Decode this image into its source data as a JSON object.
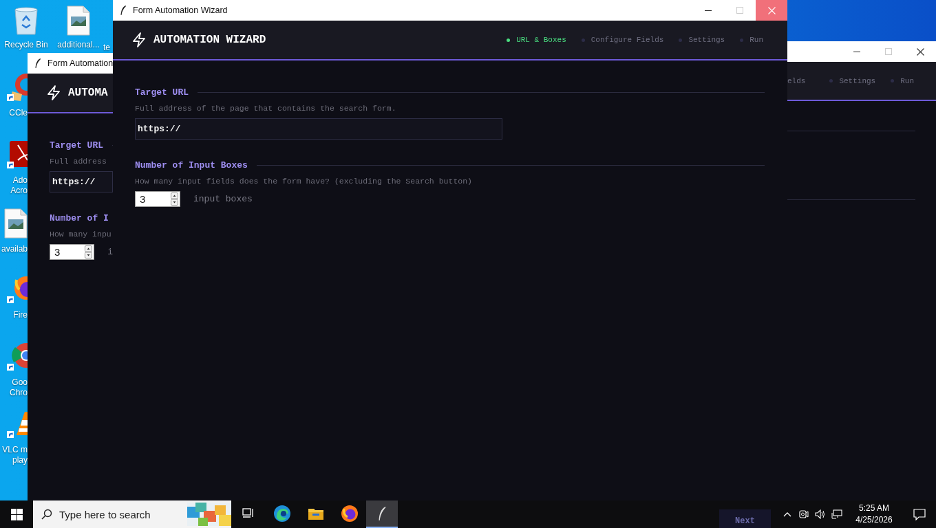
{
  "desktop": {
    "icons_top": [
      {
        "kind": "recycle",
        "label": "Recycle Bin"
      },
      {
        "kind": "image_file",
        "label": "additional..."
      },
      {
        "kind": "none",
        "label": "te"
      }
    ],
    "icons_side": [
      {
        "kind": "ccleaner",
        "lines": [
          "CCle"
        ]
      },
      {
        "kind": "acrobat",
        "lines": [
          "Ado",
          "Acro"
        ]
      },
      {
        "kind": "image_file",
        "lines": [
          "availab"
        ]
      },
      {
        "kind": "firefox",
        "lines": [
          "Fire"
        ]
      },
      {
        "kind": "chrome",
        "lines": [
          "Goo",
          "Chro"
        ]
      },
      {
        "kind": "vlc",
        "lines": [
          "VLC m",
          "play"
        ]
      }
    ]
  },
  "back_window_left": {
    "title": "Form Automation",
    "heading": "AUTOMA",
    "sections": [
      {
        "kind": "text",
        "heading": "Target URL",
        "description": "Full address",
        "value": "https://"
      },
      {
        "kind": "spin",
        "heading": "Number of I",
        "description": "How many inpu",
        "value": "3",
        "unit": "i"
      }
    ]
  },
  "back_window_right": {
    "partial_step": "elds",
    "steps": [
      {
        "label": "Settings",
        "selected": false
      },
      {
        "label": "Run",
        "selected": false
      }
    ]
  },
  "window": {
    "title": "Form Automation Wizard",
    "heading": "AUTOMATION WIZARD",
    "steps": [
      {
        "label": "URL & Boxes",
        "selected": true
      },
      {
        "label": "Configure Fields",
        "selected": false
      },
      {
        "label": "Settings",
        "selected": false
      },
      {
        "label": "Run",
        "selected": false
      }
    ],
    "sections": [
      {
        "kind": "text",
        "heading": "Target URL",
        "description": "Full address of the page that contains the search form.",
        "value": "https://"
      },
      {
        "kind": "spin",
        "heading": "Number of Input Boxes",
        "description": "How many input fields does the form have? (excluding the Search button)",
        "value": "3",
        "unit": "input boxes"
      }
    ]
  },
  "next_button": {
    "label": "Next"
  },
  "taskbar": {
    "search": {
      "placeholder": "Type here to search"
    },
    "apps": [
      {
        "kind": "task_view",
        "selected": false
      },
      {
        "kind": "edge",
        "selected": false
      },
      {
        "kind": "explorer",
        "selected": false
      },
      {
        "kind": "firefox",
        "selected": false
      },
      {
        "kind": "feather",
        "selected": true
      }
    ],
    "time": "5:25 AM",
    "date": "4/25/2026"
  }
}
